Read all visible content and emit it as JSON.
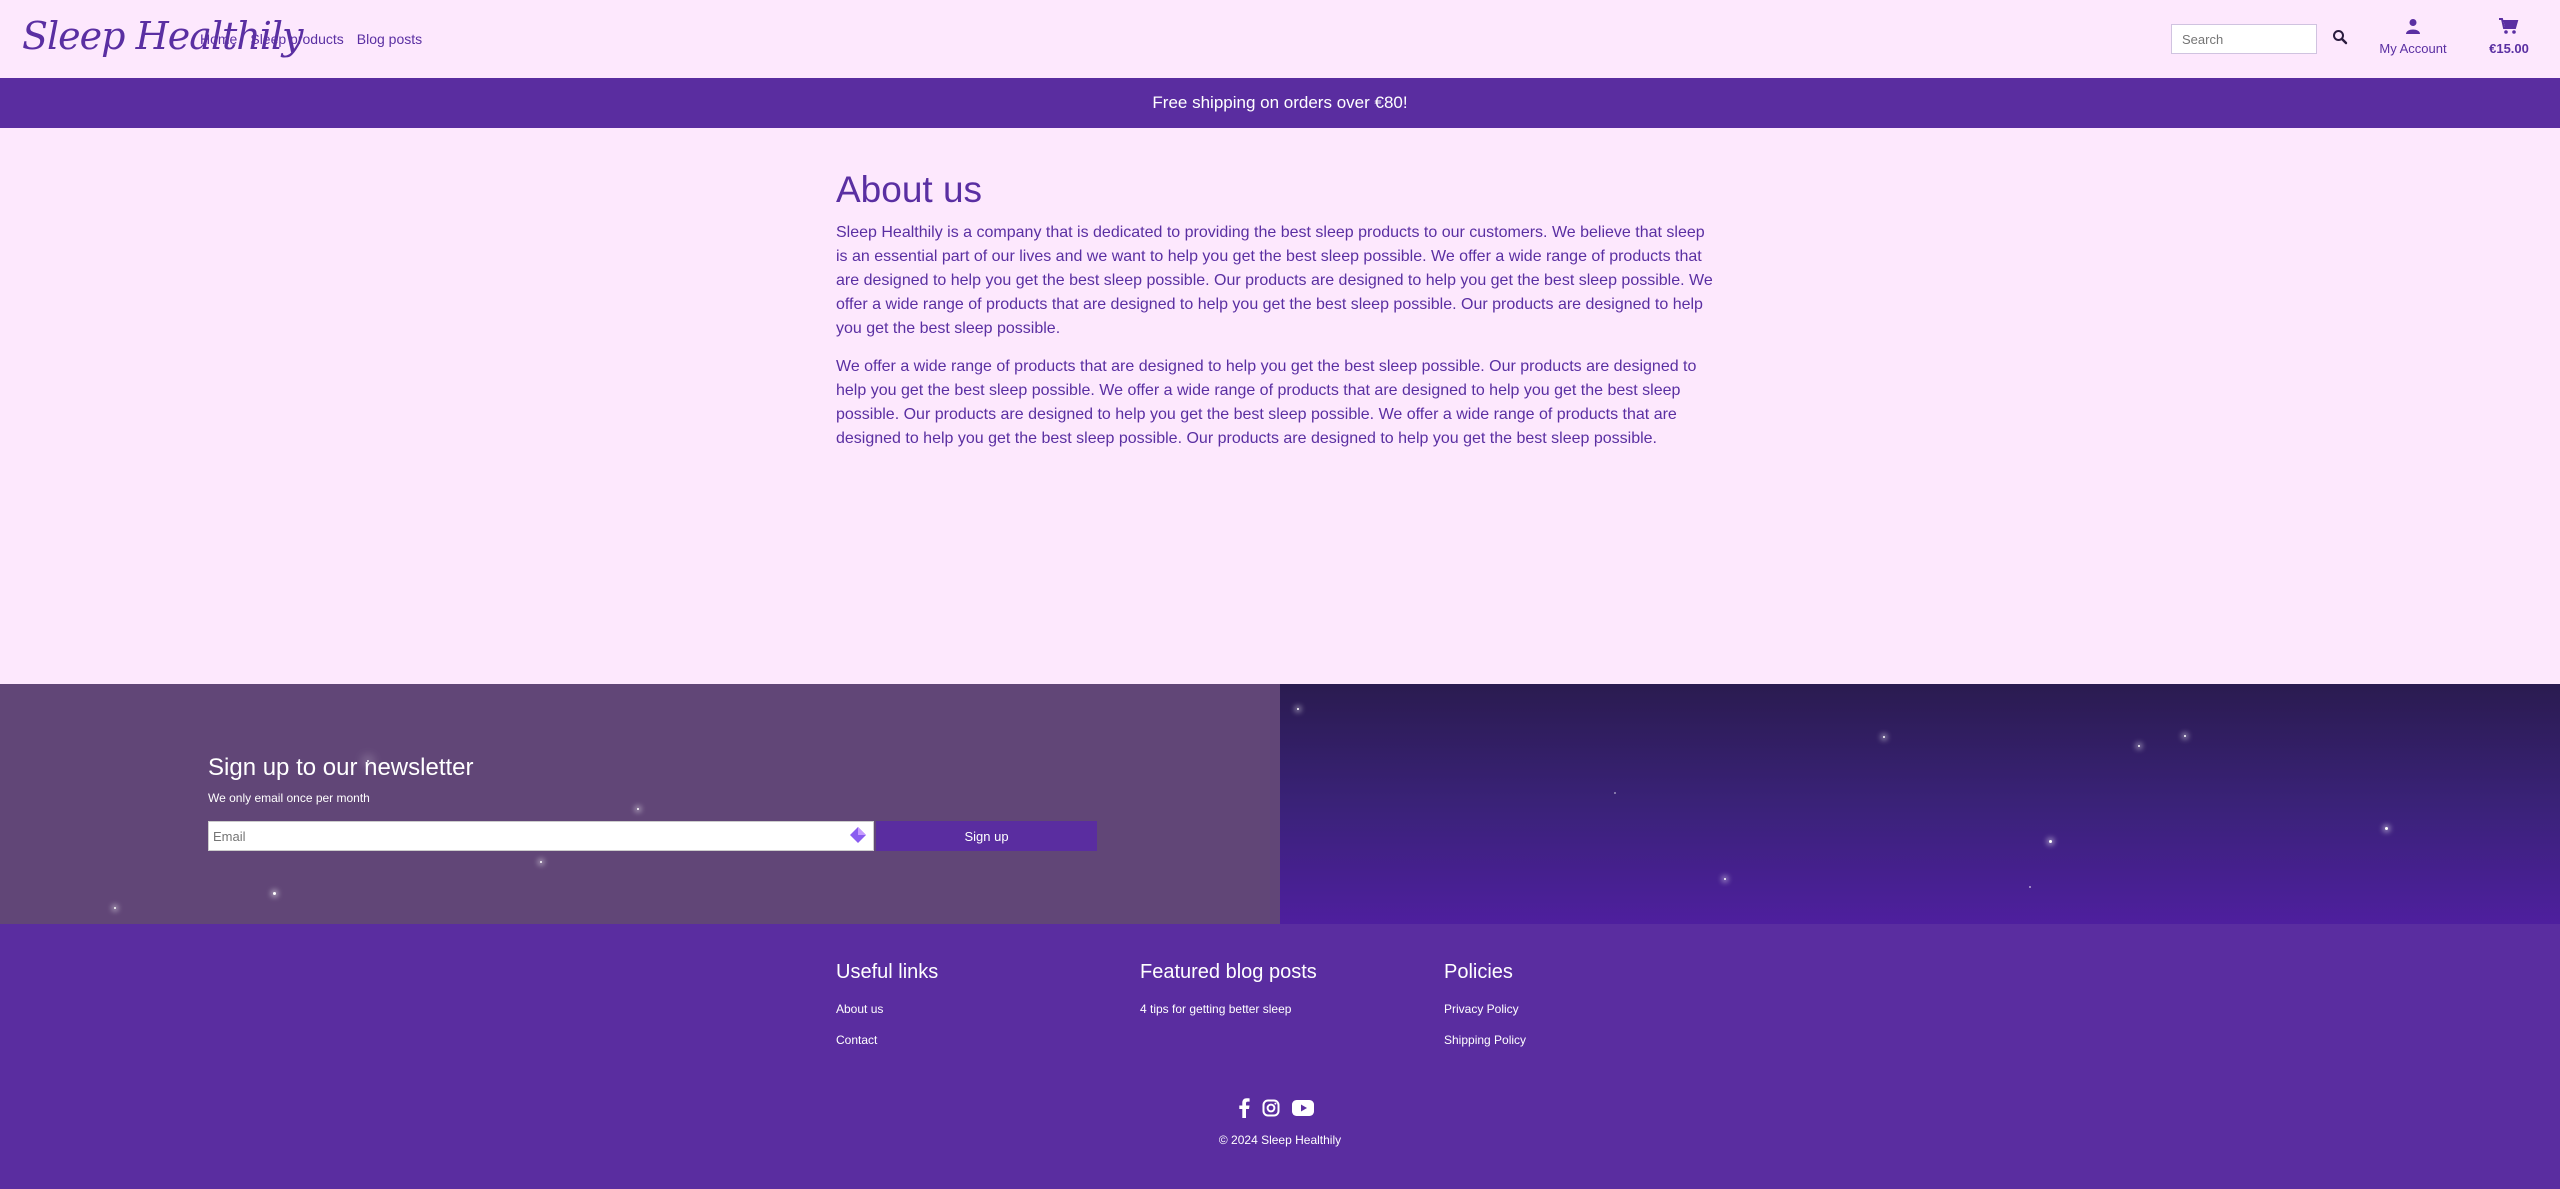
{
  "header": {
    "logo": "Sleep Healthily",
    "nav": [
      "Home",
      "Sleep products",
      "Blog posts"
    ],
    "search_placeholder": "Search",
    "account_label": "My Account",
    "cart_total": "€15.00"
  },
  "banner": {
    "text": "Free shipping on orders over €80!"
  },
  "main": {
    "title": "About us",
    "paragraphs": [
      "Sleep Healthily is a company that is dedicated to providing the best sleep products to our customers. We believe that sleep is an essential part of our lives and we want to help you get the best sleep possible. We offer a wide range of products that are designed to help you get the best sleep possible. Our products are designed to help you get the best sleep possible. We offer a wide range of products that are designed to help you get the best sleep possible. Our products are designed to help you get the best sleep possible.",
      "We offer a wide range of products that are designed to help you get the best sleep possible. Our products are designed to help you get the best sleep possible. We offer a wide range of products that are designed to help you get the best sleep possible. Our products are designed to help you get the best sleep possible. We offer a wide range of products that are designed to help you get the best sleep possible. Our products are designed to help you get the best sleep possible."
    ]
  },
  "newsletter": {
    "title": "Sign up to our newsletter",
    "subtitle": "We only email once per month",
    "email_placeholder": "Email",
    "button_label": "Sign up"
  },
  "footer": {
    "columns": [
      {
        "title": "Useful links",
        "links": [
          "About us",
          "Contact"
        ]
      },
      {
        "title": "Featured blog posts",
        "links": [
          "4 tips for getting better sleep"
        ]
      },
      {
        "title": "Policies",
        "links": [
          "Privacy Policy",
          "Shipping Policy"
        ]
      }
    ],
    "social_icons": [
      "facebook-icon",
      "instagram-icon",
      "youtube-icon"
    ],
    "copyright": "© 2024 Sleep Healthily"
  },
  "colors": {
    "page_bg": "#fde8fd",
    "brand_purple": "#5a2da0",
    "newsletter_left": "#614677",
    "newsletter_right": "#3a2278"
  }
}
